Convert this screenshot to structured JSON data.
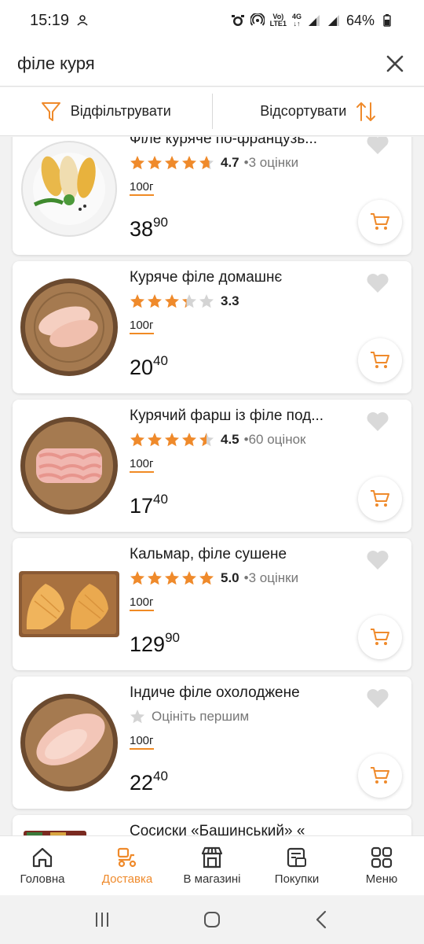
{
  "status_bar": {
    "time": "15:19",
    "network_label_top": "Vo)",
    "network_label_bottom": "LTE1",
    "network_gen": "4G",
    "battery": "64%"
  },
  "search": {
    "query": "філе куря",
    "close_icon": "close-icon"
  },
  "filters": {
    "filter_label": "Відфільтрувати",
    "sort_label": "Відсортувати"
  },
  "colors": {
    "accent": "#ef8a2b",
    "star_gray": "#d4d4d4",
    "heart_gray": "#d9d9d9"
  },
  "products": [
    {
      "title": "Філе куряче по-французь...",
      "rating": 4.7,
      "rating_text": "4.7",
      "reviews": "3 оцінки",
      "unit": "100г",
      "price_main": "38",
      "price_cents": "90",
      "image": "breaded-chicken-plate"
    },
    {
      "title": "Куряче філе домашнє",
      "rating": 3.3,
      "rating_text": "3.3",
      "reviews": "",
      "unit": "100г",
      "price_main": "20",
      "price_cents": "40",
      "image": "raw-chicken-board"
    },
    {
      "title": "Курячий фарш із філе под...",
      "rating": 4.5,
      "rating_text": "4.5",
      "reviews": "60 оцінок",
      "unit": "100г",
      "price_main": "17",
      "price_cents": "40",
      "image": "minced-meat-board"
    },
    {
      "title": "Кальмар, філе сушене",
      "rating": 5.0,
      "rating_text": "5.0",
      "reviews": "3 оцінки",
      "unit": "100г",
      "price_main": "129",
      "price_cents": "90",
      "image": "dried-squid-board"
    },
    {
      "title": "Індиче філе охолоджене",
      "rating": 0,
      "rating_text": "",
      "reviews": "Оцініть першим",
      "unit": "100г",
      "price_main": "22",
      "price_cents": "40",
      "image": "turkey-fillet-board"
    },
    {
      "title": "Сосиски «Башинський» «",
      "rating": null,
      "rating_text": "",
      "reviews": "",
      "unit": "",
      "price_main": "",
      "price_cents": "",
      "image": "sausages-pack"
    }
  ],
  "bottom_nav": [
    {
      "label": "Головна",
      "icon": "home-icon",
      "active": false
    },
    {
      "label": "Доставка",
      "icon": "delivery-scooter-icon",
      "active": true
    },
    {
      "label": "В магазині",
      "icon": "store-icon",
      "active": false
    },
    {
      "label": "Покупки",
      "icon": "purchases-icon",
      "active": false
    },
    {
      "label": "Меню",
      "icon": "menu-grid-icon",
      "active": false
    }
  ]
}
